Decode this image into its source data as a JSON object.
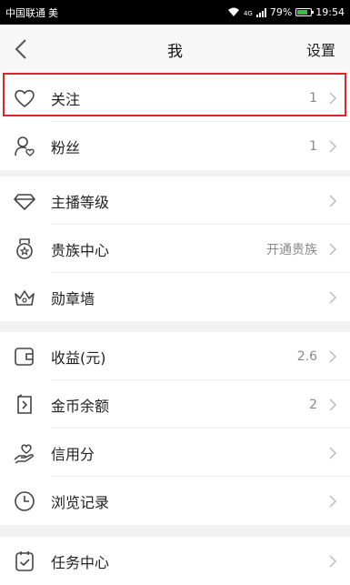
{
  "status_bar": {
    "carrier": "中国联通",
    "carrier_extra": "美",
    "network": "4G",
    "battery": "79%",
    "battery_level": 0.79,
    "time": "19:54"
  },
  "header": {
    "back_icon": "chevron-left-icon",
    "title": "我",
    "settings_label": "设置"
  },
  "groups": [
    {
      "items": [
        {
          "icon": "heart-icon",
          "label": "关注",
          "value": "1",
          "highlighted": true
        },
        {
          "icon": "fans-icon",
          "label": "粉丝",
          "value": "1"
        }
      ]
    },
    {
      "items": [
        {
          "icon": "diamond-icon",
          "label": "主播等级",
          "value": ""
        },
        {
          "icon": "medal-icon",
          "label": "贵族中心",
          "value": "开通贵族"
        },
        {
          "icon": "crown-icon",
          "label": "勋章墙",
          "value": ""
        }
      ]
    },
    {
      "items": [
        {
          "icon": "wallet-icon",
          "label": "收益(元)",
          "value": "2.6"
        },
        {
          "icon": "coin-icon",
          "label": "金币余额",
          "value": "2"
        },
        {
          "icon": "credit-hand-icon",
          "label": "信用分",
          "value": ""
        },
        {
          "icon": "clock-icon",
          "label": "浏览记录",
          "value": ""
        }
      ]
    },
    {
      "items": [
        {
          "icon": "task-icon",
          "label": "任务中心",
          "value": ""
        }
      ]
    }
  ],
  "colors": {
    "highlight": "#e0242e",
    "battery": "#27c93f"
  }
}
